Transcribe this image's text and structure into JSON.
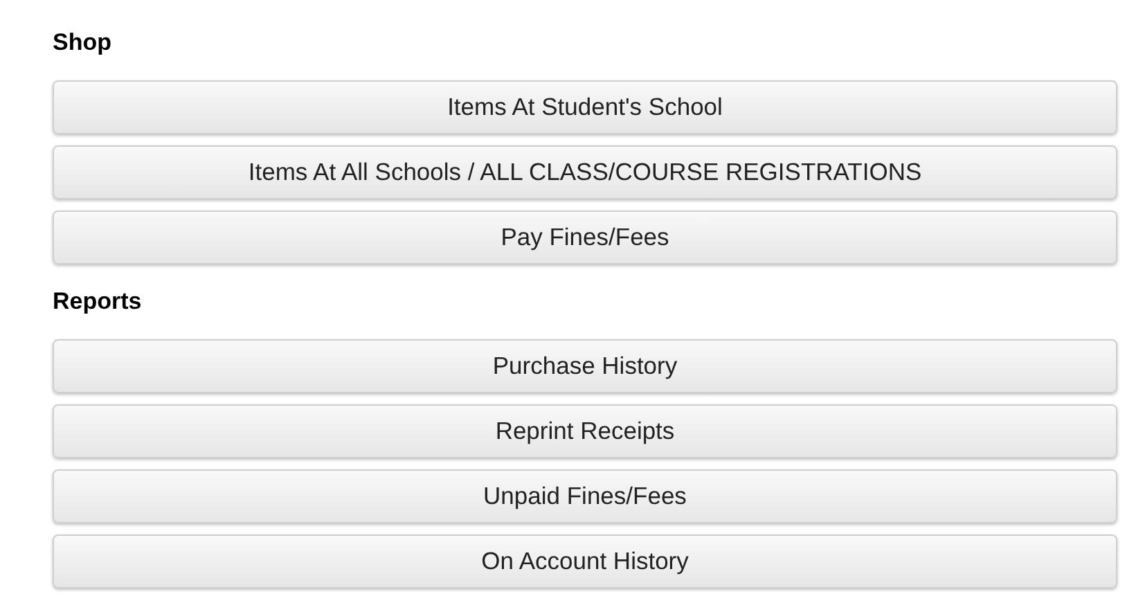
{
  "sections": [
    {
      "heading": "Shop",
      "buttons": [
        "Items At Student's School",
        "Items At All Schools / ALL CLASS/COURSE REGISTRATIONS",
        "Pay Fines/Fees"
      ]
    },
    {
      "heading": "Reports",
      "buttons": [
        "Purchase History",
        "Reprint Receipts",
        "Unpaid Fines/Fees",
        "On Account History"
      ]
    }
  ]
}
